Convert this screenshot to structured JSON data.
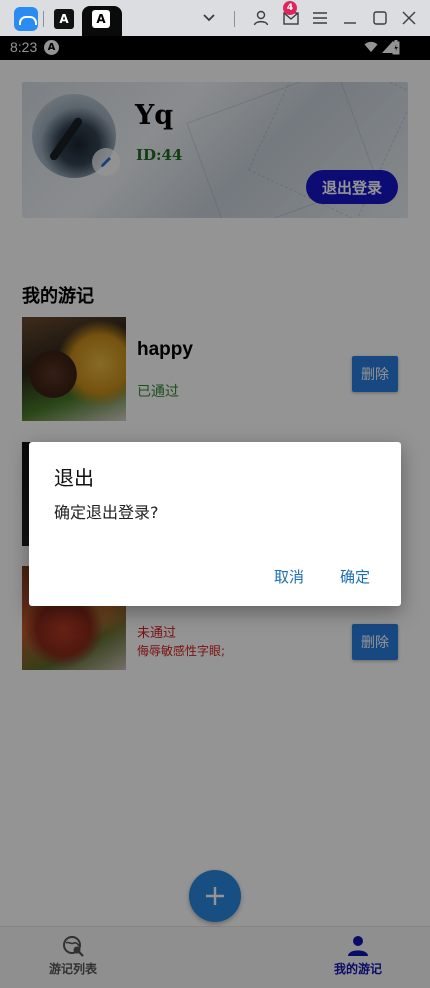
{
  "window_bar": {
    "badge_count": "4",
    "tab2_glyph": "A",
    "tab3_glyph": "A"
  },
  "status_bar": {
    "time": "8:23",
    "app_icon_glyph": "A"
  },
  "profile": {
    "username": "Yq",
    "user_id": "ID:44",
    "logout_label": "退出登录"
  },
  "section_title": "我的游记",
  "items": [
    {
      "title": "happy",
      "status": "已通过",
      "delete_label": "删除"
    },
    {
      "status": "未通过",
      "reason": "侮辱敏感性字眼;",
      "delete_label": "删除"
    }
  ],
  "bottom_nav": {
    "left_label": "游记列表",
    "right_label": "我的游记",
    "fab_icon": "plus-icon"
  },
  "dialog": {
    "title": "退出",
    "message": "确定退出登录?",
    "cancel_label": "取消",
    "confirm_label": "确定"
  },
  "colors": {
    "logout_button": "#1515c8",
    "delete_button": "#2a7de1",
    "approved": "#2d8a2d",
    "rejected": "#d42020",
    "nav_active": "#1212b4",
    "dialog_button": "#1a6fb3"
  }
}
